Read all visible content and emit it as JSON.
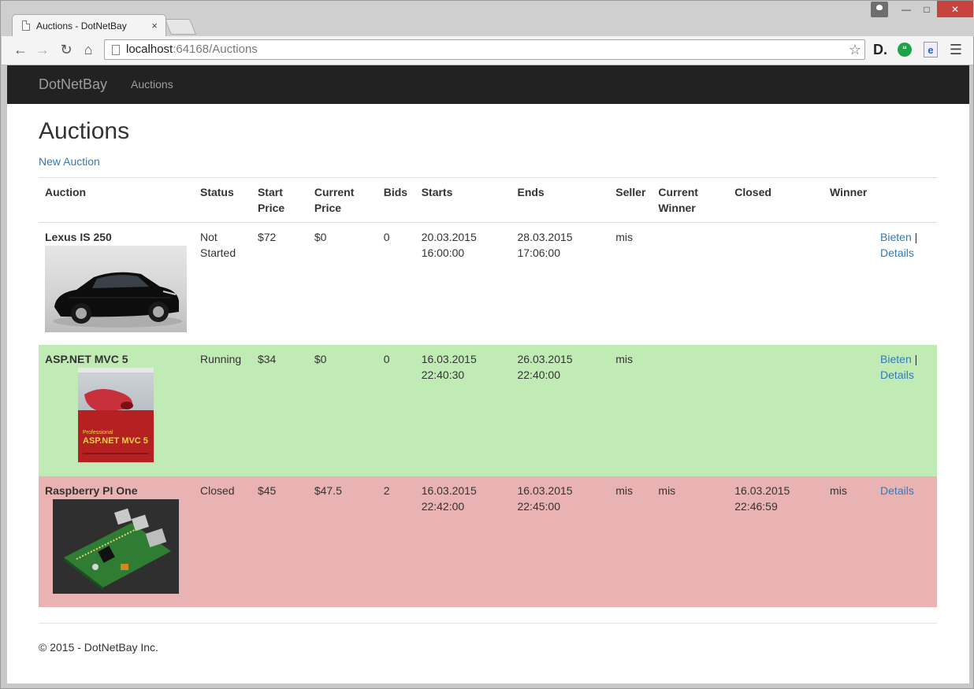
{
  "browser": {
    "tab_title": "Auctions - DotNetBay",
    "tab_close": "×",
    "url_host": "localhost",
    "url_path": ":64168/Auctions"
  },
  "navbar": {
    "brand": "DotNetBay",
    "links": [
      "Auctions"
    ]
  },
  "page": {
    "title": "Auctions",
    "new_link": "New Auction"
  },
  "table": {
    "headers": {
      "auction": "Auction",
      "status": "Status",
      "start_price_1": "Start",
      "start_price_2": "Price",
      "current_price_1": "Current",
      "current_price_2": "Price",
      "bids": "Bids",
      "starts": "Starts",
      "ends": "Ends",
      "seller": "Seller",
      "current_winner_1": "Current",
      "current_winner_2": "Winner",
      "closed": "Closed",
      "winner": "Winner"
    },
    "rows": [
      {
        "title": "Lexus IS 250",
        "image": "car-photo",
        "status_1": "Not",
        "status_2": "Started",
        "start_price": "$72",
        "current_price": "$0",
        "bids": "0",
        "starts_date": "20.03.2015",
        "starts_time": "16:00:00",
        "ends_date": "28.03.2015",
        "ends_time": "17:06:00",
        "seller": "mis",
        "current_winner": "",
        "closed_date": "",
        "closed_time": "",
        "winner": "",
        "bid_link": "Bieten",
        "separator": " |",
        "details_link": "Details"
      },
      {
        "title": "ASP.NET MVC 5",
        "image": "book-cover",
        "status_1": "Running",
        "status_2": "",
        "start_price": "$34",
        "current_price": "$0",
        "bids": "0",
        "starts_date": "16.03.2015",
        "starts_time": "22:40:30",
        "ends_date": "26.03.2015",
        "ends_time": "22:40:00",
        "seller": "mis",
        "current_winner": "",
        "closed_date": "",
        "closed_time": "",
        "winner": "",
        "bid_link": "Bieten",
        "separator": " |",
        "details_link": "Details",
        "row_color": "#c1ebb5"
      },
      {
        "title": "Raspberry PI One",
        "image": "circuit-board-photo",
        "status_1": "Closed",
        "status_2": "",
        "start_price": "$45",
        "current_price": "$47.5",
        "bids": "2",
        "starts_date": "16.03.2015",
        "starts_time": "22:42:00",
        "ends_date": "16.03.2015",
        "ends_time": "22:45:00",
        "seller": "mis",
        "current_winner": "mis",
        "closed_date": "16.03.2015",
        "closed_time": "22:46:59",
        "winner": "mis",
        "details_link": "Details",
        "row_color": "#eab3b3"
      }
    ]
  },
  "footer": {
    "text": "© 2015 - DotNetBay Inc."
  },
  "colors": {
    "navbar_bg": "#222222",
    "link": "#337ab7",
    "success_row": "#c1ebb5",
    "danger_row": "#eab3b3"
  }
}
